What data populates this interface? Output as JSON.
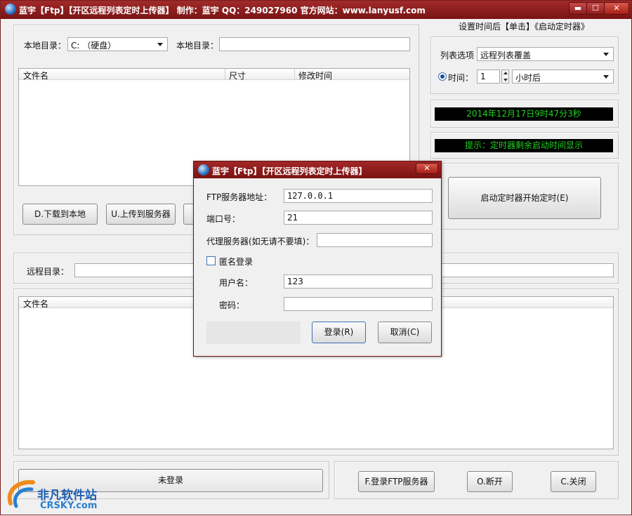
{
  "window": {
    "title": "蓝宇【Ftp】【开区远程列表定时上传器】 制作：蓝宇 QQ：249027960 官方网站：www.lanyusf.com",
    "minimize": "▬",
    "maximize": "☐",
    "close": "✕"
  },
  "local": {
    "dir_label": "本地目录：",
    "drive_value": "C: （硬盘）",
    "dir_label2": "本地目录：",
    "dir_value": ""
  },
  "local_list": {
    "columns": [
      "文件名",
      "尺寸",
      "修改时间"
    ]
  },
  "local_buttons": {
    "download": "D.下载到本地",
    "upload": "U.上传到服务器"
  },
  "timer": {
    "header": "设置时间后【单击】《启动定时器》",
    "list_option_label": "列表选项",
    "list_option_value": "远程列表覆盖",
    "time_label": "时间：",
    "time_value": "1",
    "unit_value": "小时后",
    "datetime": "2014年12月17日9时47分3秒",
    "hint": "提示：定时器剩余启动时间显示",
    "start_button": "启动定时器开始定时(E)"
  },
  "remote": {
    "dir_label": "远程目录：",
    "dir_value": "",
    "columns": [
      "文件名"
    ]
  },
  "bottom": {
    "status": "未登录",
    "login_button": "F.登录FTP服务器",
    "disconnect_button": "O.断开",
    "close_button": "C.关闭"
  },
  "dialog": {
    "title": "蓝宇【Ftp】【开区远程列表定时上传器】",
    "close": "✕",
    "server_label": "FTP服务器地址：",
    "server_value": "127.0.0.1",
    "port_label": "端口号：",
    "port_value": "21",
    "proxy_label": "代理服务器(如无请不要填)：",
    "proxy_value": "",
    "anonymous_label": "匿名登录",
    "username_label": "用户名：",
    "username_value": "123",
    "password_label": "密码：",
    "password_value": "",
    "login_button": "登录(R)",
    "cancel_button": "取消(C)"
  },
  "watermark": {
    "cn": "非凡软件站",
    "en": "CRSKY.com"
  }
}
